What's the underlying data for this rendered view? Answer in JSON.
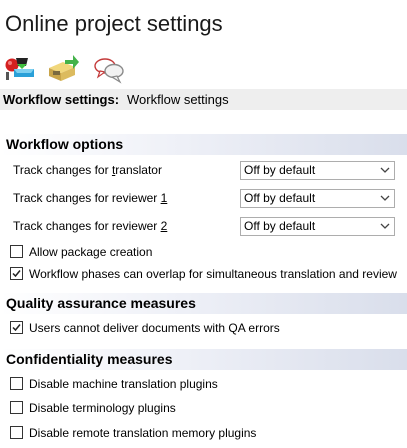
{
  "title": "Online project settings",
  "toolbar": {
    "items": [
      {
        "name": "workflow-settings",
        "icon": "workflow-settings-icon"
      },
      {
        "name": "package",
        "icon": "package-icon"
      },
      {
        "name": "communication",
        "icon": "communication-icon"
      }
    ]
  },
  "workflow_settings": {
    "label": "Workflow settings:",
    "value": "Workflow settings"
  },
  "sections": {
    "workflow_options": "Workflow options",
    "quality_assurance": "Quality assurance measures",
    "confidentiality": "Confidentiality measures"
  },
  "track_changes": [
    {
      "label_before": "Track changes for ",
      "label_accel": "t",
      "label_after": "ranslator",
      "value": "Off by default"
    },
    {
      "label_before": "Track changes for reviewer ",
      "label_accel": "1",
      "label_after": "",
      "value": "Off by default"
    },
    {
      "label_before": "Track changes for reviewer ",
      "label_accel": "2",
      "label_after": "",
      "value": "Off by default"
    }
  ],
  "checkboxes": {
    "allow_package_creation": {
      "label": "Allow package creation",
      "checked": false
    },
    "phases_overlap": {
      "label": "Workflow phases can overlap for simultaneous translation and review",
      "checked": true
    },
    "qa_errors": {
      "label": "Users cannot deliver documents with QA errors",
      "checked": true
    },
    "disable_mt": {
      "label": "Disable machine translation plugins",
      "checked": false
    },
    "disable_terminology": {
      "label": "Disable terminology plugins",
      "checked": false
    },
    "disable_remote_tm": {
      "label": "Disable remote translation memory plugins",
      "checked": false
    }
  },
  "colors": {
    "section_gradient_end": "#d9deeb",
    "strip_background": "#eeeeee"
  }
}
